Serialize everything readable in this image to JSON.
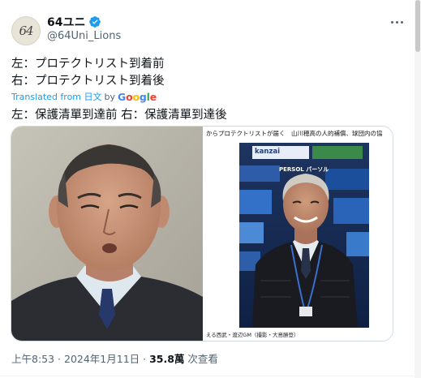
{
  "author": {
    "display_name": "64ユニ",
    "handle": "@64Uni_Lions",
    "avatar_text": "64"
  },
  "tweet": {
    "lines": [
      "左：プロテクトリスト到着前",
      "右：プロテクトリスト到着後"
    ],
    "translated_prefix": "Translated from",
    "translated_lang": "日文",
    "translated_by": "by",
    "google_letters": [
      {
        "ch": "G",
        "color": "#4285f4"
      },
      {
        "ch": "o",
        "color": "#ea4335"
      },
      {
        "ch": "o",
        "color": "#fbbc05"
      },
      {
        "ch": "g",
        "color": "#4285f4"
      },
      {
        "ch": "l",
        "color": "#34a853"
      },
      {
        "ch": "e",
        "color": "#ea4335"
      }
    ],
    "translation": "左：保護清單到達前 右：保護清單到達後"
  },
  "media": {
    "right_caption": "からプロテクトリストが届く　山川穂高の人的補償、球団内の協",
    "right_sponsor1": "kanzai",
    "right_sponsor2": "PERSOL パーソル",
    "right_credit": "える西武・渡辺GM（撮影・大島勝登）"
  },
  "footer": {
    "time": "上午8:53",
    "sep1": " · ",
    "date": "2024年1月11日",
    "sep2": " · ",
    "views_count": "35.8萬",
    "views_label": " 次查看"
  },
  "colors": {
    "verified": "#1d9bf0",
    "link": "#1d9bf0",
    "secondary": "#536471"
  }
}
